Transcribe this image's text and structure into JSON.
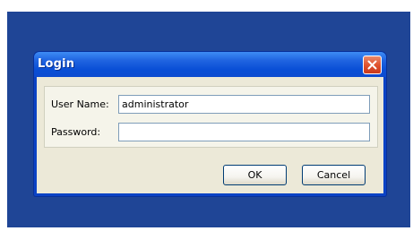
{
  "dialog": {
    "title": "Login",
    "close_icon": "close-icon"
  },
  "form": {
    "username_label": "User Name:",
    "username_value": "administrator",
    "password_label": "Password:",
    "password_value": ""
  },
  "buttons": {
    "ok_label": "OK",
    "cancel_label": "Cancel"
  },
  "colors": {
    "desktop": "#1f4596",
    "titlebar": "#0a4fd6",
    "close_button": "#e0542f",
    "dialog_face": "#ece9d8"
  }
}
